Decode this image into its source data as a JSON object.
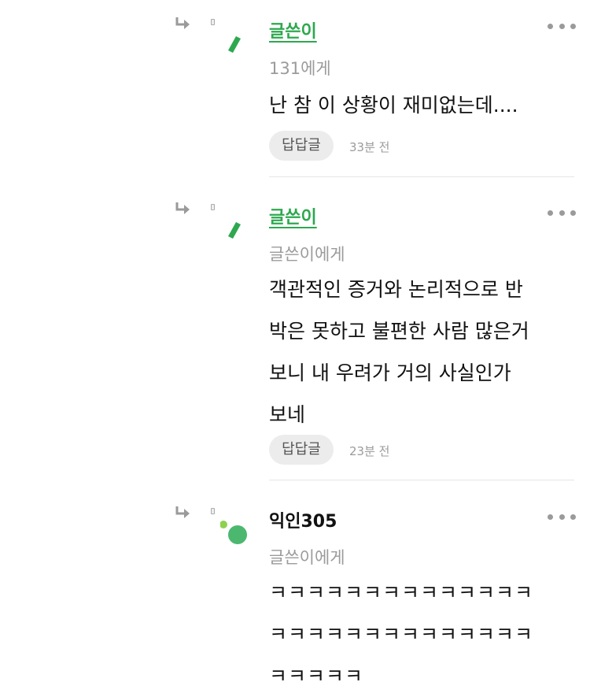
{
  "comments": [
    {
      "author": "글쓴이",
      "recipient": "131에게",
      "body": "난 참 이 상황이 재미없는데....",
      "reply_label": "답답글",
      "time": "33분 전"
    },
    {
      "author": "글쓴이",
      "recipient": "글쓴이에게",
      "body": "객관적인 증거와 논리적으로 반\n박은 못하고 불편한 사람 많은거\n보니 내 우려가 거의 사실인가\n보네",
      "reply_label": "답답글",
      "time": "23분 전"
    },
    {
      "author": "익인305",
      "recipient": "글쓴이에게",
      "body": "ㅋㅋㅋㅋㅋㅋㅋㅋㅋㅋㅋㅋㅋㅋ\nㅋㅋㅋㅋㅋㅋㅋㅋㅋㅋㅋㅋㅋㅋ\nㅋㅋㅋㅋㅋ"
    }
  ],
  "icons": {
    "reply_arrow": "reply-arrow-icon",
    "more": "more-options-icon",
    "writer_avatar": "pencil-avatar-icon",
    "anon_avatar": "anonymous-avatar-icon"
  },
  "colors": {
    "writer_accent": "#2ea84f",
    "muted_text": "#9b9b9b",
    "reply_button_bg": "#ececec",
    "anon_avatar_dot": "#8fd14f",
    "anon_avatar_circle": "#4cb86f"
  }
}
